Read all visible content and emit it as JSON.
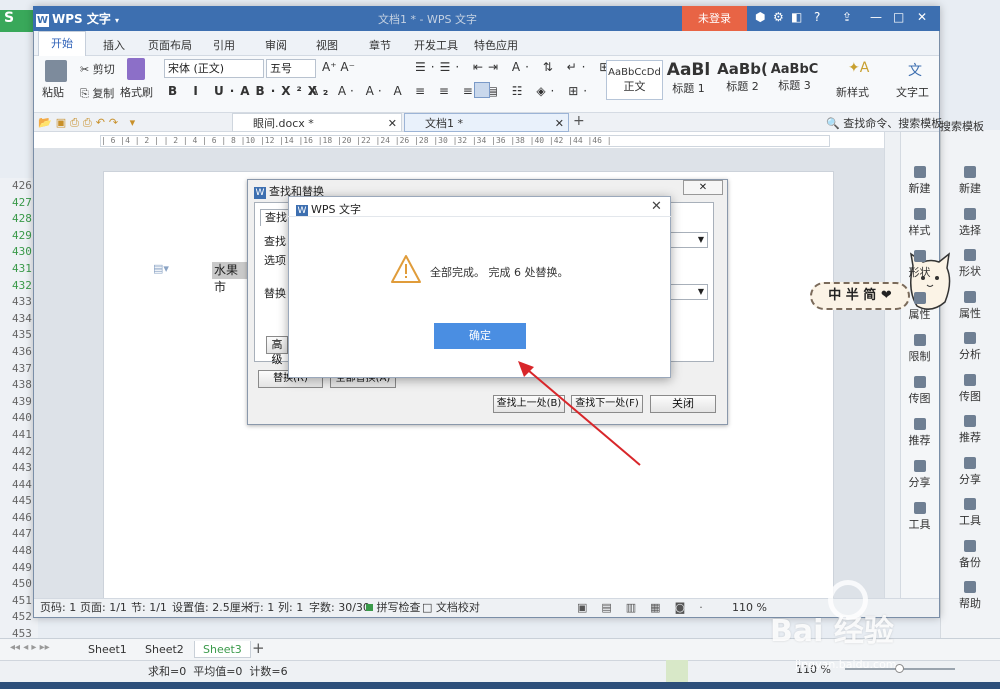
{
  "spreadsheet": {
    "row_numbers": [
      "426",
      "427",
      "428",
      "429",
      "430",
      "431",
      "432",
      "433",
      "434",
      "435",
      "436",
      "437",
      "438",
      "439",
      "440",
      "441",
      "442",
      "443",
      "444",
      "445",
      "446",
      "447",
      "448",
      "449",
      "450",
      "451",
      "452",
      "453",
      "454"
    ],
    "sheets": [
      "Sheet1",
      "Sheet2",
      "Sheet3"
    ],
    "add_sheet": "+",
    "status": "求和=0  平均值=0  计数=6",
    "zoom": "110 %"
  },
  "bg_right_panel": [
    {
      "icon": "new-doc-icon",
      "label": "新建"
    },
    {
      "icon": "select-icon",
      "label": "选择"
    },
    {
      "icon": "shape-icon",
      "label": "形状"
    },
    {
      "icon": "property-icon",
      "label": "属性"
    },
    {
      "icon": "analyze-icon",
      "label": "分析"
    },
    {
      "icon": "image-icon",
      "label": "传图"
    },
    {
      "icon": "recommend-icon",
      "label": "推荐"
    },
    {
      "icon": "share-icon",
      "label": "分享"
    },
    {
      "icon": "tool-icon",
      "label": "工具"
    },
    {
      "icon": "backup-icon",
      "label": "备份"
    },
    {
      "icon": "help-icon",
      "label": "帮助"
    }
  ],
  "bg_search": "搜索模板",
  "window": {
    "app_name": "WPS 文字",
    "title": "文档1 * - WPS 文字",
    "login": "未登录"
  },
  "menu": [
    "开始",
    "插入",
    "页面布局",
    "引用",
    "审阅",
    "视图",
    "章节",
    "开发工具",
    "特色应用"
  ],
  "ribbon": {
    "paste": "粘贴",
    "cut": "剪切",
    "copy": "复制",
    "format_painter": "格式刷",
    "font": "宋体 (正文)",
    "size": "五号",
    "styles": [
      {
        "preview": "AaBbCcDd",
        "label": "正文"
      },
      {
        "preview": "AaBl",
        "label": "标题 1"
      },
      {
        "preview": "AaBb(",
        "label": "标题 2"
      },
      {
        "preview": "AaBbC",
        "label": "标题 3"
      }
    ],
    "new_style": "新样式",
    "text_tool": "文字工"
  },
  "doc_tabs": [
    {
      "name": "眼间.docx *"
    },
    {
      "name": "文档1 *"
    }
  ],
  "search_placeholder": "查找命令、搜索模板",
  "ruler_text": "| 6 |4 | 2 |  | 2 | 4 | 6 | 8 |10 |12 |14 |16 |18 |20 |22 |24 |26 |28 |30 |32 |34 |36 |38 |40 |42 |44 |46 |",
  "side_panel": [
    {
      "icon": "new-doc-icon",
      "label": "新建"
    },
    {
      "icon": "style-icon",
      "label": "样式"
    },
    {
      "icon": "shape-icon",
      "label": "形状"
    },
    {
      "icon": "property-icon",
      "label": "属性"
    },
    {
      "icon": "limit-icon",
      "label": "限制"
    },
    {
      "icon": "image-icon",
      "label": "传图"
    },
    {
      "icon": "recommend-icon",
      "label": "推荐"
    },
    {
      "icon": "share-icon",
      "label": "分享"
    },
    {
      "icon": "tool-icon",
      "label": "工具"
    }
  ],
  "document": {
    "text": "水果市"
  },
  "statusbar": {
    "page_num": "页码: 1",
    "page": "页面: 1/1",
    "section": "节: 1/1",
    "setting": "设置值: 2.5厘米",
    "row": "行: 1",
    "col": "列: 1",
    "words": "字数: 30/30",
    "spell": "拼写检查",
    "proof": "文档校对",
    "zoom": "110 %"
  },
  "find_replace": {
    "title": "查找和替换",
    "tab": "查找",
    "find_label": "查找",
    "options_label": "选项",
    "replace_label": "替换",
    "advanced": "高级",
    "replace_btn": "替换(R)",
    "replace_all_btn": "全部替换(A)",
    "find_prev": "查找上一处(B)",
    "find_next": "查找下一处(F)",
    "close": "关闭"
  },
  "message": {
    "title": "WPS 文字",
    "text": "全部完成。 完成 6 处替换。",
    "ok": "确定"
  },
  "sticker": {
    "text": "中 半 简"
  },
  "watermark": "Bai 经验",
  "watermark_url": "jingyan.baidu.com"
}
